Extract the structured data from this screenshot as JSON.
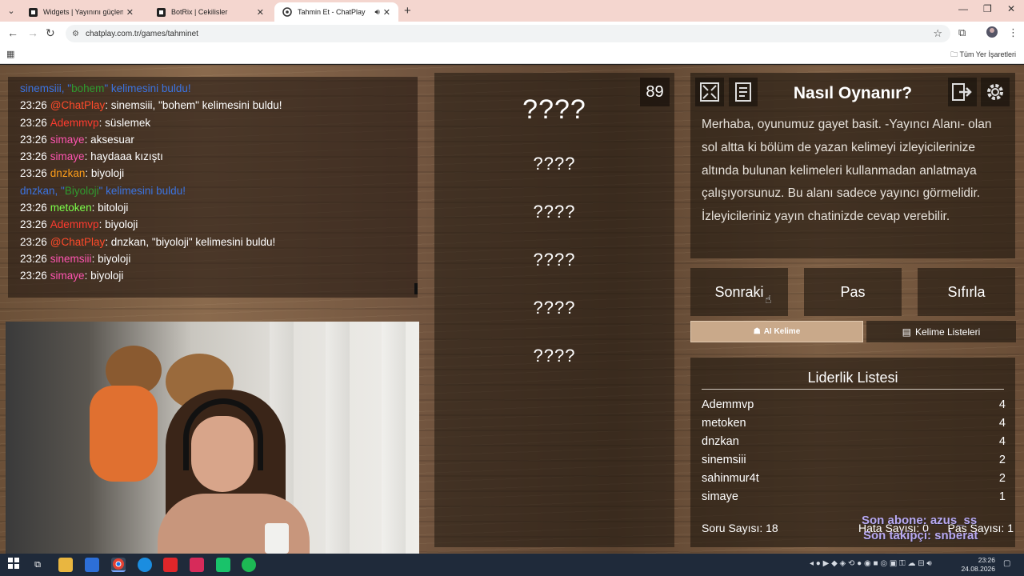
{
  "browser": {
    "tabs": [
      {
        "title": "Widgets | Yayınını güçlendirmek",
        "icon": "botrix-icon"
      },
      {
        "title": "BotRix | Cekilisler",
        "icon": "botrix-icon"
      },
      {
        "title": "Tahmin Et - ChatPlay",
        "icon": "chatplay-icon",
        "active": true
      }
    ],
    "url": "chatplay.com.tr/games/tahminet",
    "bookmarks_label": "Tüm Yer İşaretleri"
  },
  "chat": {
    "lines": [
      {
        "type": "system",
        "pre": "sinemsiii, \"",
        "word": "bohem",
        "post": "\" kelimesini buldu!"
      },
      {
        "time": "23:26",
        "user": "@ChatPlay",
        "color": "#ff4a2a",
        "msg": ": sinemsiii, \"bohem\" kelimesini buldu!"
      },
      {
        "time": "23:26",
        "user": "Ademmvp",
        "color": "#ff3b2f",
        "msg": ": süslemek"
      },
      {
        "time": "23:26",
        "user": "simaye",
        "color": "#ff54b0",
        "msg": ": aksesuar"
      },
      {
        "time": "23:26",
        "user": "simaye",
        "color": "#ff54b0",
        "msg": ": haydaaa kızıştı"
      },
      {
        "time": "23:26",
        "user": "dnzkan",
        "color": "#ff9f1a",
        "msg": ": biyoloji"
      },
      {
        "type": "system",
        "pre": "dnzkan, \"",
        "word": "Biyoloji",
        "post": "\" kelimesini buldu!"
      },
      {
        "time": "23:26",
        "user": "metoken",
        "color": "#7cff4a",
        "msg": ": bitoloji"
      },
      {
        "time": "23:26",
        "user": "Ademmvp",
        "color": "#ff3b2f",
        "msg": ": biyoloji"
      },
      {
        "time": "23:26",
        "user": "@ChatPlay",
        "color": "#ff4a2a",
        "msg": ": dnzkan, \"biyoloji\" kelimesini buldu!"
      },
      {
        "time": "23:26",
        "user": "sinemsiii",
        "color": "#ff54b0",
        "msg": ": biyoloji"
      },
      {
        "time": "23:26",
        "user": "simaye",
        "color": "#ff54b0",
        "msg": ": biyoloji"
      }
    ]
  },
  "game": {
    "timer": "89",
    "main_word": "????",
    "hidden_words": [
      "????",
      "????",
      "????",
      "????",
      "????"
    ]
  },
  "howto": {
    "title": "Nasıl Oynanır?",
    "text": "Merhaba, oyunumuz gayet basit. -Yayıncı Alanı- olan sol altta ki bölüm de yazan kelimeyi izleyicilerinize altında bulunan kelimeleri kullanmadan anlatmaya çalışıyorsunuz. Bu alanı sadece yayıncı görmelidir. İzleyicileriniz yayın chatinizde cevap verebilir."
  },
  "controls": {
    "next": "Sonraki",
    "pass": "Pas",
    "reset": "Sıfırla",
    "ai_tab": "AI Kelime",
    "lists_tab": "Kelime Listeleri"
  },
  "leaderboard": {
    "title": "Liderlik Listesi",
    "rows": [
      {
        "name": "Ademmvp",
        "score": "4"
      },
      {
        "name": "metoken",
        "score": "4"
      },
      {
        "name": "dnzkan",
        "score": "4"
      },
      {
        "name": "sinemsiii",
        "score": "2"
      },
      {
        "name": "sahinmur4t",
        "score": "2"
      },
      {
        "name": "simaye",
        "score": "1"
      }
    ],
    "question_count": "Soru Sayısı: 18",
    "error_count": "Hata Sayısı: 0",
    "pass_count": "Pas Sayısı: 1"
  },
  "overlay": {
    "last_sub": "Son abone: azus_ss",
    "last_follower": "Son takipçi: snberat"
  },
  "taskbar": {
    "time": "23:26",
    "date": "24.08.2026"
  }
}
